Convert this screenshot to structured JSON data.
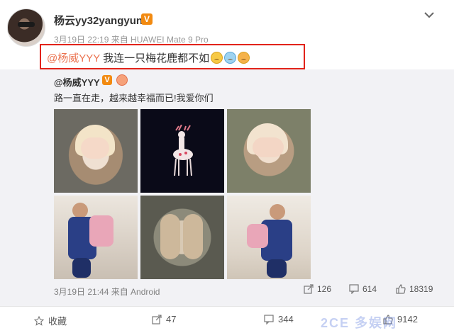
{
  "post": {
    "username": "杨云yy32yangyun",
    "verified_badge": "V",
    "meta": "3月19日 22:19 来自 HUAWEI Mate 9 Pro",
    "mention": "@杨威YYY",
    "text": " 我连一只梅花鹿都不如"
  },
  "repost": {
    "username": "@杨威YYY",
    "verified_badge": "V",
    "text": "路一直在走，越来越幸福而已!我爱你们",
    "footer": "3月19日 21:44 来自 Android",
    "stats": {
      "forward": "126",
      "comment": "614",
      "like": "18319"
    }
  },
  "actions": {
    "favorite": "收藏",
    "forward": "47",
    "comment": "344",
    "like": "9142"
  },
  "watermark": "2CE 多娱网",
  "colors": {
    "accent": "#eb7350",
    "highlight_border": "#e2231a",
    "badge": "#f28a11"
  }
}
